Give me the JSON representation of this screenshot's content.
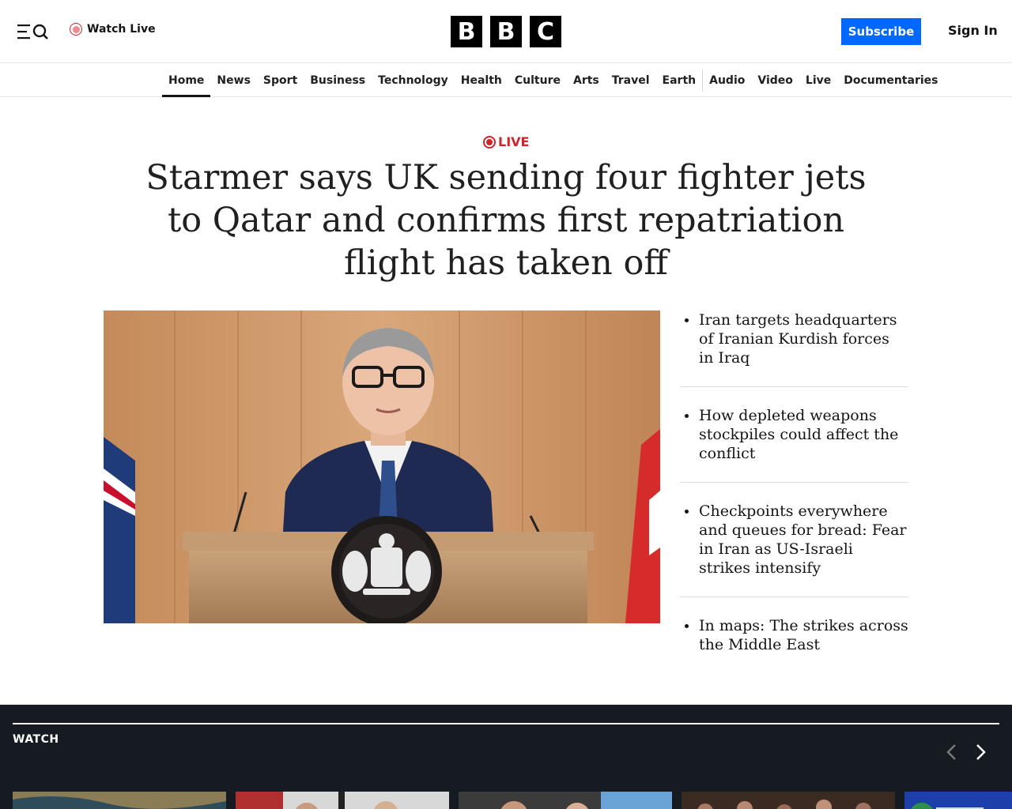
{
  "header": {
    "watch_live": "Watch Live",
    "logo_letters": [
      "B",
      "B",
      "C"
    ],
    "subscribe": "Subscribe",
    "sign_in": "Sign In"
  },
  "nav": {
    "items": [
      "Home",
      "News",
      "Sport",
      "Business",
      "Technology",
      "Health",
      "Culture",
      "Arts",
      "Travel",
      "Earth",
      "Audio",
      "Video",
      "Live",
      "Documentaries"
    ],
    "active": "Home"
  },
  "lead": {
    "tag": "LIVE",
    "headline": "Starmer says UK sending four fighter jets to Qatar and confirms first repatriation flight has taken off"
  },
  "related": [
    "Iran targets headquarters of Iranian Kurdish forces in Iraq",
    "How depleted weapons stockpiles could affect the conflict",
    "Checkpoints everywhere and queues for bread: Fear in Iran as US-Israeli strikes intensify",
    "In maps: The strikes across the Middle East"
  ],
  "watch": {
    "title": "WATCH"
  },
  "colors": {
    "accent_blue": "#0068ff",
    "live_red": "#d1232a",
    "watch_bg": "#151b21"
  }
}
